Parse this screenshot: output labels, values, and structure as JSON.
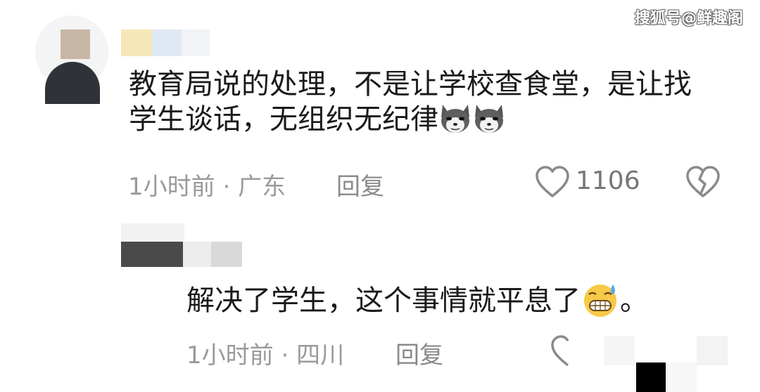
{
  "watermark": "搜狐号@鲜趣阁",
  "comment1": {
    "text": "教育局说的处理，不是让学校查食堂，是让找学生谈话，无组织无纪律",
    "emojis": [
      "husky-dog-emoji",
      "husky-dog-emoji"
    ],
    "time": "1小时前",
    "separator": "·",
    "location": "广东",
    "reply_label": "回复",
    "likes": "1106"
  },
  "comment2": {
    "text": "解决了学生，这个事情就平息了",
    "emoji": "sweat-grin-emoji",
    "suffix": "。",
    "time": "1小时前",
    "separator": "·",
    "location": "四川",
    "reply_label": "回复"
  },
  "colors": {
    "meta": "#9a9a9a",
    "text": "#1a1a1a",
    "icon": "#8a8a8a"
  }
}
